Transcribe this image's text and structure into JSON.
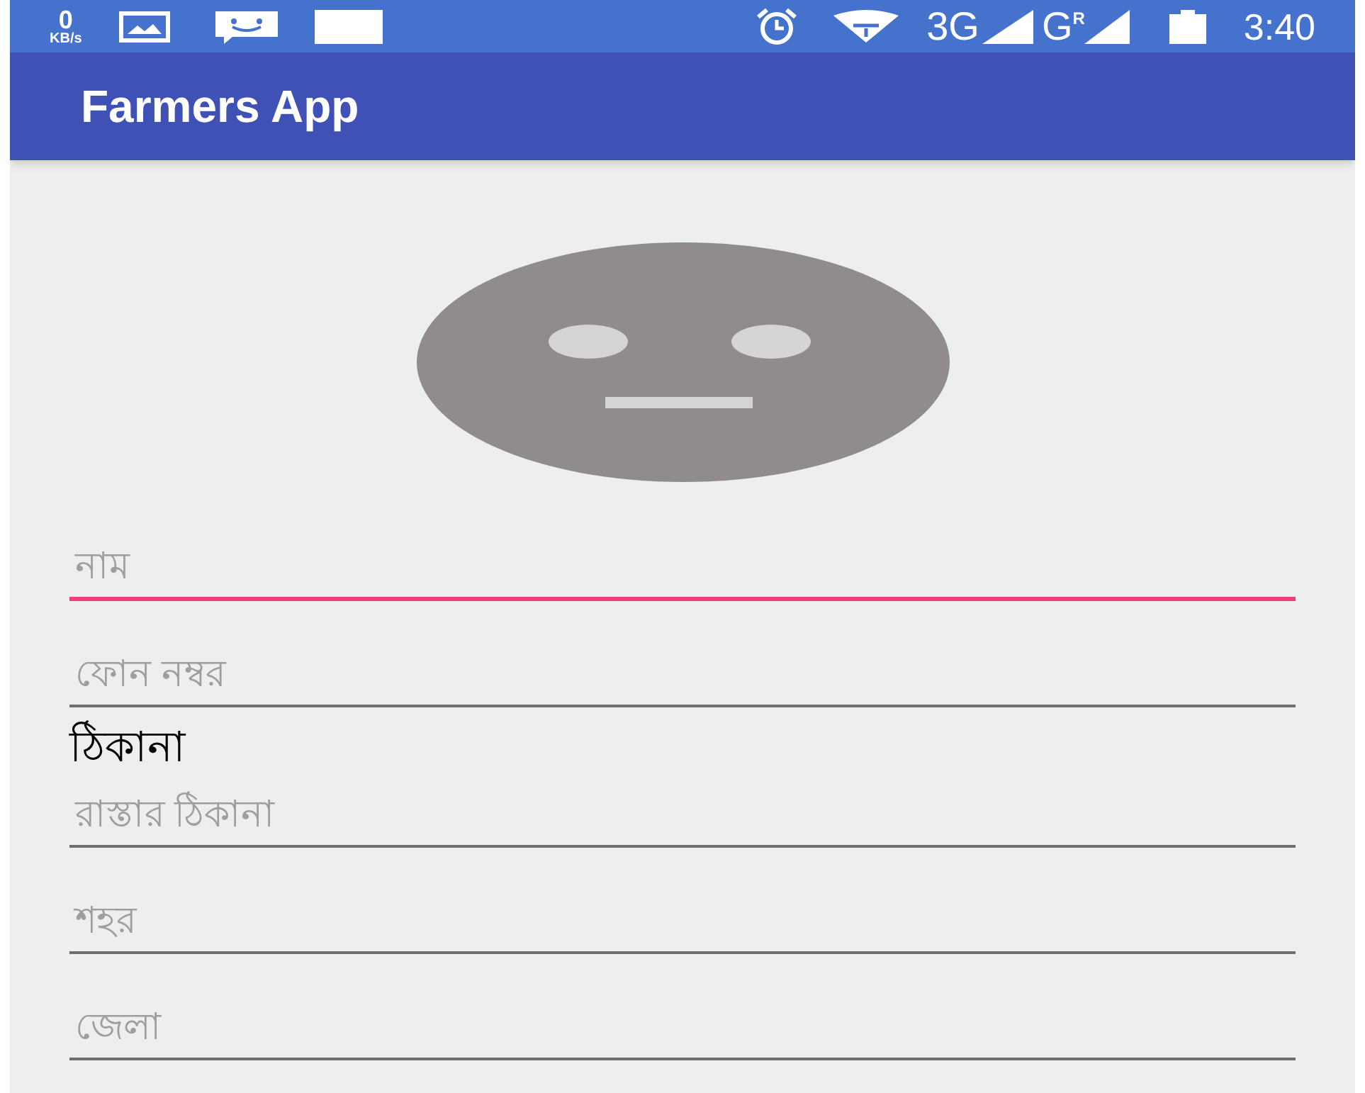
{
  "status_bar": {
    "speed_value": "0",
    "speed_unit": "KB/s",
    "network_1": "3G",
    "network_2": "G",
    "roaming": "R",
    "time": "3:40"
  },
  "app_bar": {
    "title": "Farmers App"
  },
  "form": [
    {
      "kind": "field",
      "placeholder": "নাম",
      "focused": true
    },
    {
      "kind": "field",
      "placeholder": "ফোন নম্বর",
      "focused": false
    },
    {
      "kind": "heading",
      "text": "ঠিকানা"
    },
    {
      "kind": "field",
      "placeholder": "রাস্তার ঠিকানা",
      "focused": false
    },
    {
      "kind": "field",
      "placeholder": "শহর",
      "focused": false
    },
    {
      "kind": "field",
      "placeholder": "জেলা",
      "focused": false
    }
  ]
}
